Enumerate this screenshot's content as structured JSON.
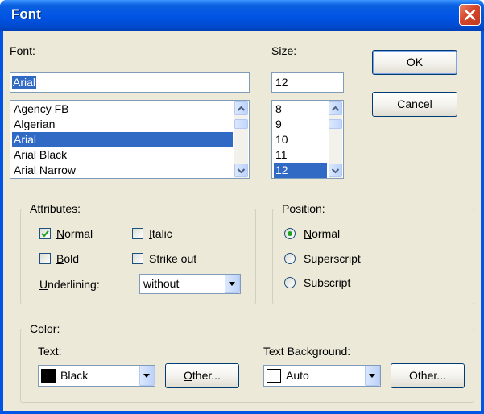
{
  "window": {
    "title": "Font"
  },
  "font": {
    "label": "Font:",
    "value": "Arial",
    "items": [
      "Agency FB",
      "Algerian",
      "Arial",
      "Arial Black",
      "Arial Narrow"
    ],
    "selected_index": 2
  },
  "size": {
    "label": "Size:",
    "value": "12",
    "items": [
      "8",
      "9",
      "10",
      "11",
      "12"
    ],
    "selected_index": 4
  },
  "buttons": {
    "ok": "OK",
    "cancel": "Cancel"
  },
  "attributes": {
    "legend": "Attributes:",
    "normal": {
      "label": "Normal",
      "checked": true
    },
    "italic": {
      "label": "Italic",
      "checked": false
    },
    "bold": {
      "label": "Bold",
      "checked": false
    },
    "strikeout": {
      "label": "Strike out",
      "checked": false
    },
    "underlining_label": "Underlining:",
    "underlining_value": "without"
  },
  "position": {
    "legend": "Position:",
    "normal": "Normal",
    "superscript": "Superscript",
    "subscript": "Subscript",
    "selected": "Normal"
  },
  "color": {
    "legend": "Color:",
    "text_label": "Text:",
    "text_value": "Black",
    "text_swatch": "#000000",
    "text_other": "Other...",
    "bg_label": "Text Background:",
    "bg_value": "Auto",
    "bg_swatch": "#ffffff",
    "bg_other": "Other..."
  }
}
